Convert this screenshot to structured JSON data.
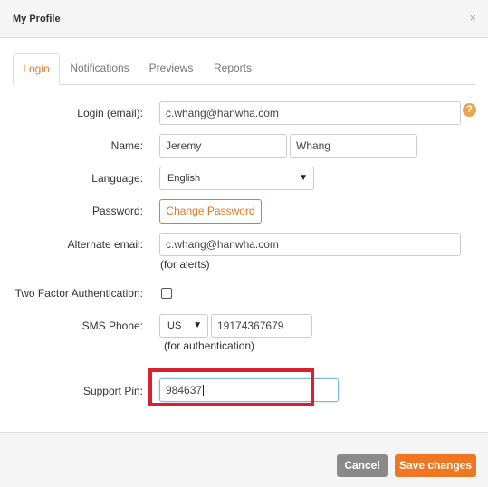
{
  "dialog": {
    "title": "My Profile",
    "close": "×"
  },
  "tabs": [
    {
      "label": "Login",
      "active": true
    },
    {
      "label": "Notifications"
    },
    {
      "label": "Previews"
    },
    {
      "label": "Reports"
    }
  ],
  "form": {
    "login_label": "Login (email):",
    "login_value": "c.whang@hanwha.com",
    "help_icon": "?",
    "name_label": "Name:",
    "first_name": "Jeremy",
    "last_name": "Whang",
    "language_label": "Language:",
    "language_value": "English",
    "password_label": "Password:",
    "change_password": "Change Password",
    "alt_email_label": "Alternate email:",
    "alt_email_value": "c.whang@hanwha.com",
    "alt_email_hint": "(for alerts)",
    "two_factor_label": "Two Factor Authentication:",
    "two_factor_checked": false,
    "sms_label": "SMS Phone:",
    "sms_country": "US",
    "sms_number": "19174367679",
    "sms_hint": "(for authentication)",
    "pin_label": "Support Pin:",
    "pin_value": "984637"
  },
  "footer": {
    "cancel": "Cancel",
    "save": "Save changes"
  },
  "colors": {
    "accent": "#e87722",
    "highlight": "#d9202f",
    "cancel_bg": "#8a8a8a"
  }
}
